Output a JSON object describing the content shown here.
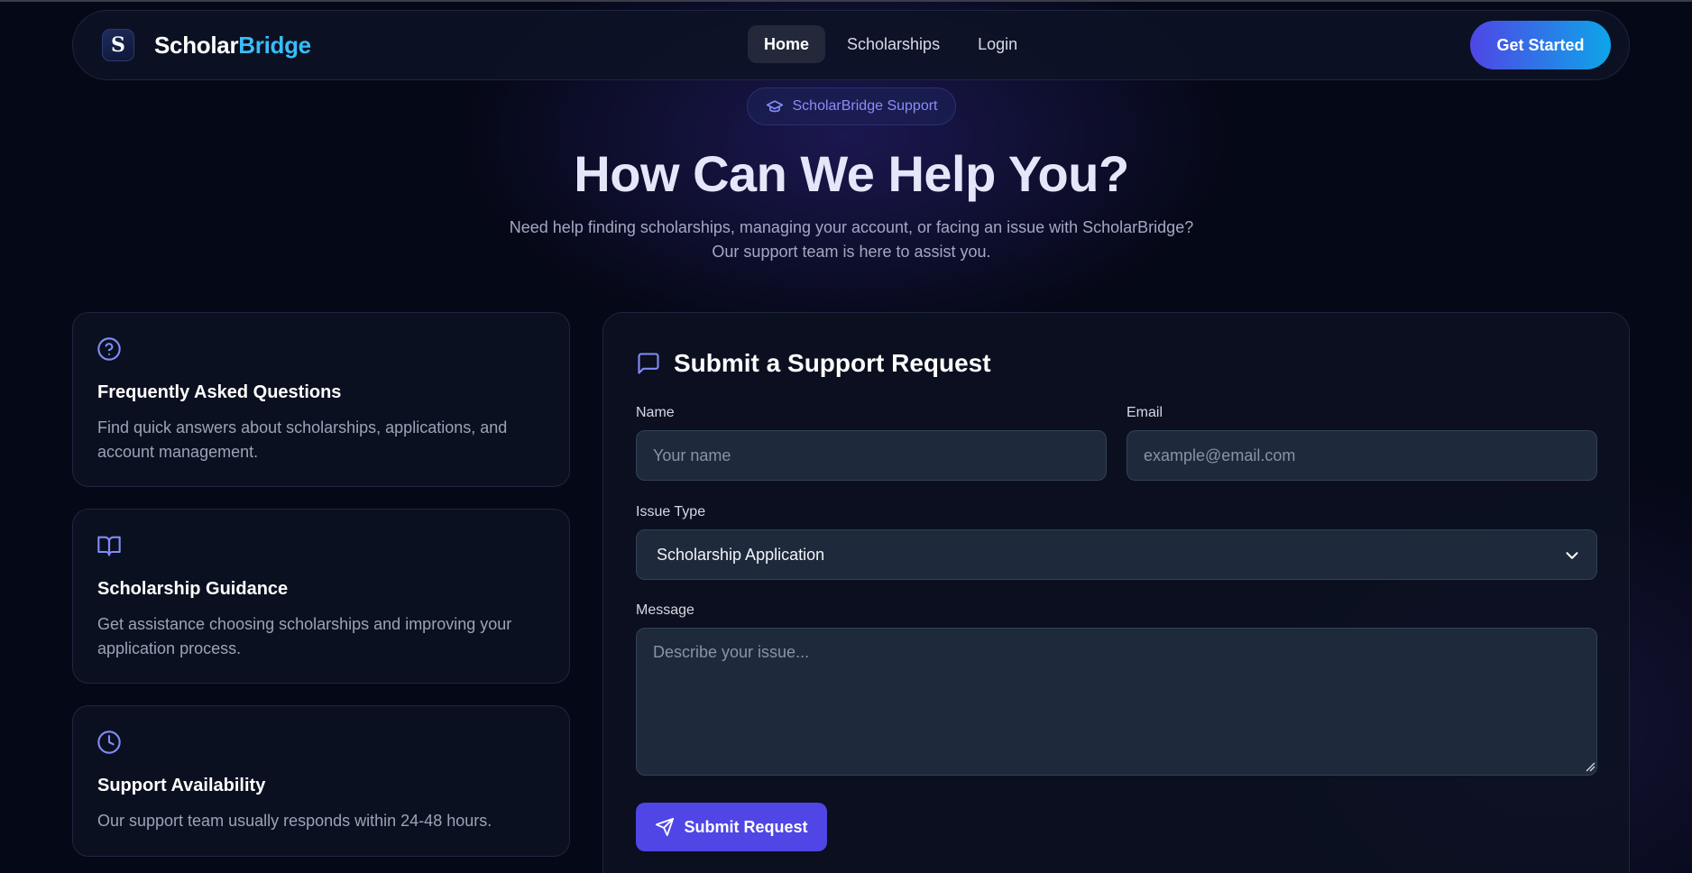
{
  "nav": {
    "brand_part1": "Scholar",
    "brand_part2": "Bridge",
    "logo_letter": "S",
    "links": [
      "Home",
      "Scholarships",
      "Login"
    ],
    "active": "Home",
    "cta_label": "Get Started"
  },
  "hero": {
    "badge": "ScholarBridge Support",
    "badge_icon": "graduation-cap-icon",
    "title": "How Can We Help You?",
    "subtitle_line1": "Need help finding scholarships, managing your account, or facing an issue with ScholarBridge?",
    "subtitle_line2": "Our support team is here to assist you."
  },
  "cards": [
    {
      "icon": "help-circle-icon",
      "title": "Frequently Asked Questions",
      "text": "Find quick answers about scholarships, applications, and account management."
    },
    {
      "icon": "book-open-icon",
      "title": "Scholarship Guidance",
      "text": "Get assistance choosing scholarships and improving your application process."
    },
    {
      "icon": "clock-icon",
      "title": "Support Availability",
      "text": "Our support team usually responds within 24-48 hours."
    }
  ],
  "form": {
    "heading": "Submit a Support Request",
    "heading_icon": "message-square-icon",
    "name_label": "Name",
    "name_placeholder": "Your name",
    "email_label": "Email",
    "email_placeholder": "example@email.com",
    "issue_label": "Issue Type",
    "issue_value": "Scholarship Application",
    "message_label": "Message",
    "message_placeholder": "Describe your issue...",
    "submit_label": "Submit Request",
    "submit_icon": "send-icon"
  },
  "colors": {
    "background": "#050816",
    "accent": "#4f46e5",
    "brand_highlight": "#38bdf8",
    "icon": "#818cf8"
  }
}
